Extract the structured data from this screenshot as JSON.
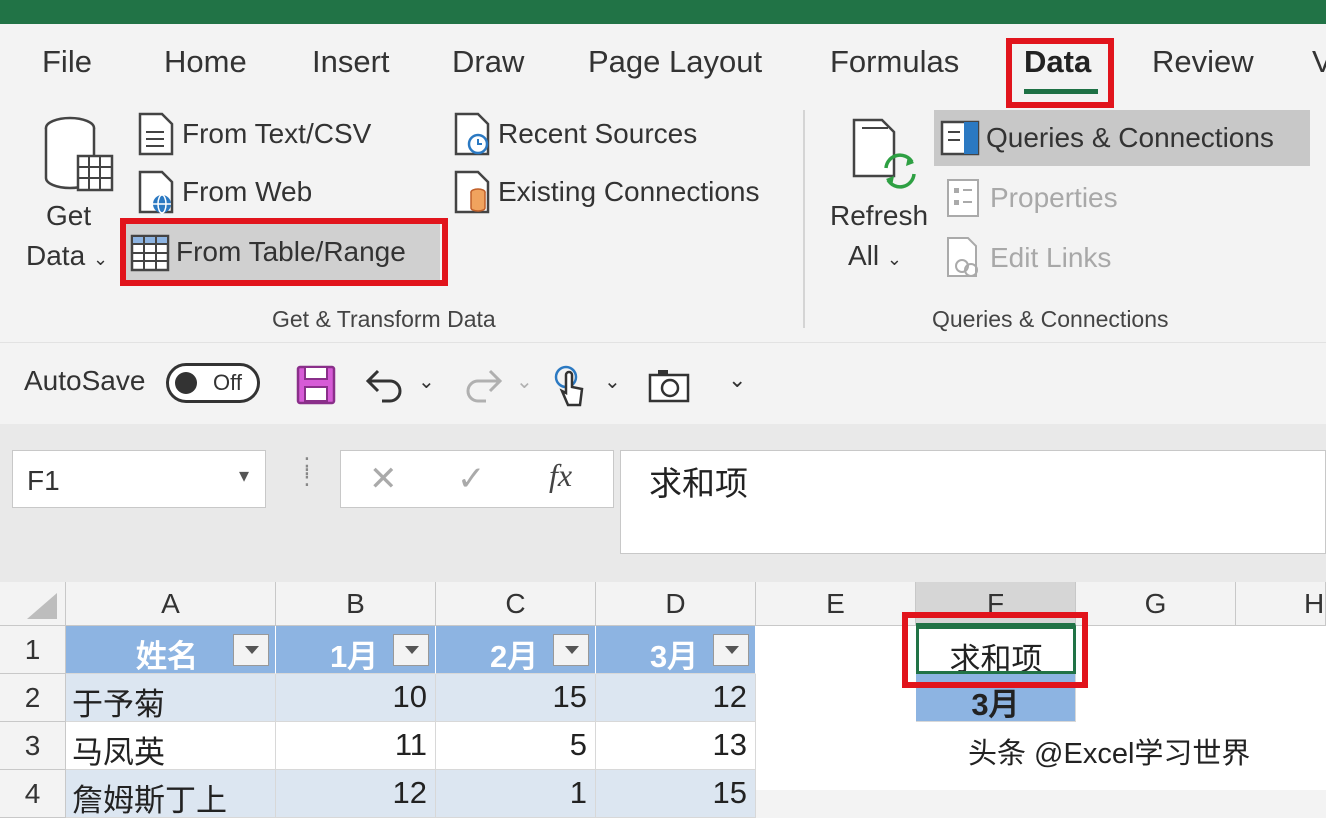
{
  "tabs": [
    "File",
    "Home",
    "Insert",
    "Draw",
    "Page Layout",
    "Formulas",
    "Data",
    "Review",
    "V"
  ],
  "active_tab": "Data",
  "get_transform": {
    "get_data_line1": "Get",
    "get_data_line2": "Data",
    "from_text_csv": "From Text/CSV",
    "from_web": "From Web",
    "from_table_range": "From Table/Range",
    "recent_sources": "Recent Sources",
    "existing_connections": "Existing Connections",
    "group_label": "Get & Transform Data"
  },
  "queries": {
    "refresh_line1": "Refresh",
    "refresh_line2": "All",
    "queries_connections": "Queries & Connections",
    "properties": "Properties",
    "edit_links": "Edit Links",
    "group_label": "Queries & Connections"
  },
  "qat": {
    "autosave": "AutoSave",
    "toggle_state": "Off"
  },
  "formula": {
    "name_box": "F1",
    "fx": "fx",
    "content": "求和项"
  },
  "grid": {
    "columns": [
      "A",
      "B",
      "C",
      "D",
      "E",
      "F",
      "G",
      "H"
    ],
    "rows": [
      "1",
      "2",
      "3",
      "4"
    ],
    "headers": [
      "姓名",
      "1月",
      "2月",
      "3月"
    ],
    "data": [
      [
        "于予菊",
        "10",
        "15",
        "12"
      ],
      [
        "马凤英",
        "11",
        "5",
        "13"
      ],
      [
        "詹姆斯丁上",
        "12",
        "1",
        "15"
      ]
    ],
    "f1": "求和项",
    "f2": "3月"
  },
  "watermark": "头条 @Excel学习世界",
  "colors": {
    "excel_green": "#217346",
    "highlight_red": "#e1141c",
    "table_header": "#8db4e2",
    "table_band": "#dce6f1"
  }
}
